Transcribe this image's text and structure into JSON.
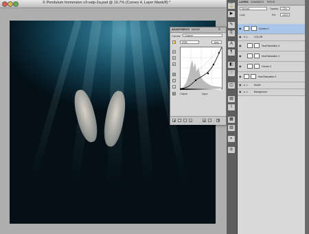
{
  "document": {
    "title": "© Pendulum Immersion v3-valp-2a.psd @ 16.7% (Curves 4, Layer Mask/8) *"
  },
  "colors": {
    "accent_selected": "#a9c6ea",
    "water_dark": "#071e29",
    "water_light": "#3f8aa3"
  },
  "adjustments_panel": {
    "tabs": [
      "ADJUSTMENTS",
      "MASKS"
    ],
    "panel_label": "Curves",
    "preset_value": "Custom",
    "channel_value": "RGB",
    "auto_label": "Auto",
    "output_label": "Output:",
    "input_label": "Input:",
    "icons": [
      "hand-on-image-icon",
      "pencil-icon",
      "eyedropper-black-icon",
      "eyedropper-gray-icon",
      "eyedropper-white-icon",
      "curve-point-icon",
      "smooth-icon",
      "clipping-icon"
    ]
  },
  "layers_panel": {
    "tabs": [
      "LAYERS",
      "CHANNELS",
      "PATHS"
    ],
    "blend_mode": "Normal",
    "opacity_label": "Opacity:",
    "opacity_value": "72%",
    "lock_label": "Lock:",
    "fill_label": "Fill:",
    "fill_value": "100%",
    "layers": [
      {
        "name": "Curves 4",
        "selected": true
      },
      {
        "name": "COLOR",
        "group": true
      },
      {
        "name": "Hue/Saturation 4"
      },
      {
        "name": "Hue/Saturation 1"
      },
      {
        "name": "Curves 2"
      },
      {
        "name": "Hue/Saturation 3"
      },
      {
        "name": "Model",
        "group": true
      },
      {
        "name": "Background",
        "group": true
      }
    ]
  }
}
